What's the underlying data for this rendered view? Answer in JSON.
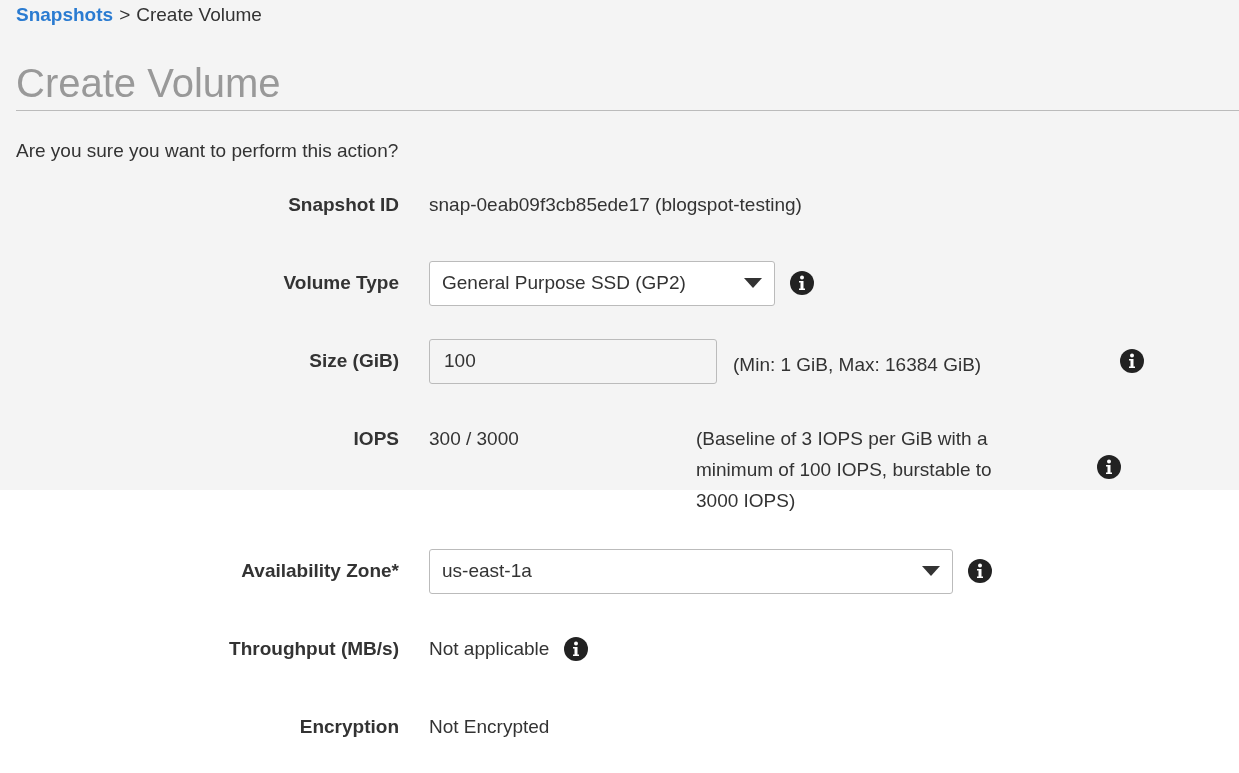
{
  "breadcrumb": {
    "link": "Snapshots",
    "separator": ">",
    "current": "Create Volume"
  },
  "title": "Create Volume",
  "prompt": "Are you sure you want to perform this action?",
  "fields": [
    {
      "kind": "text",
      "label": "Snapshot ID",
      "value": "snap-0eab09f3cb85ede17 (blogspot-testing)",
      "info": false
    },
    {
      "kind": "select",
      "label": "Volume Type",
      "value": "General Purpose SSD (GP2)",
      "info": true,
      "wide": false
    },
    {
      "kind": "input",
      "label": "Size (GiB)",
      "value": "100",
      "note": "(Min: 1 GiB, Max: 16384 GiB)",
      "info": true
    },
    {
      "kind": "noted",
      "label": "IOPS",
      "value": "300 / 3000",
      "note": "(Baseline of 3 IOPS per GiB with a minimum of 100 IOPS, burstable to 3000 IOPS)",
      "info": true
    },
    {
      "kind": "select",
      "label": "Availability Zone*",
      "value": "us-east-1a",
      "info": true,
      "wide": true
    },
    {
      "kind": "text",
      "label": "Throughput (MB/s)",
      "value": "Not applicable",
      "info": true
    },
    {
      "kind": "text",
      "label": "Encryption",
      "value": "Not Encrypted",
      "info": false
    }
  ]
}
